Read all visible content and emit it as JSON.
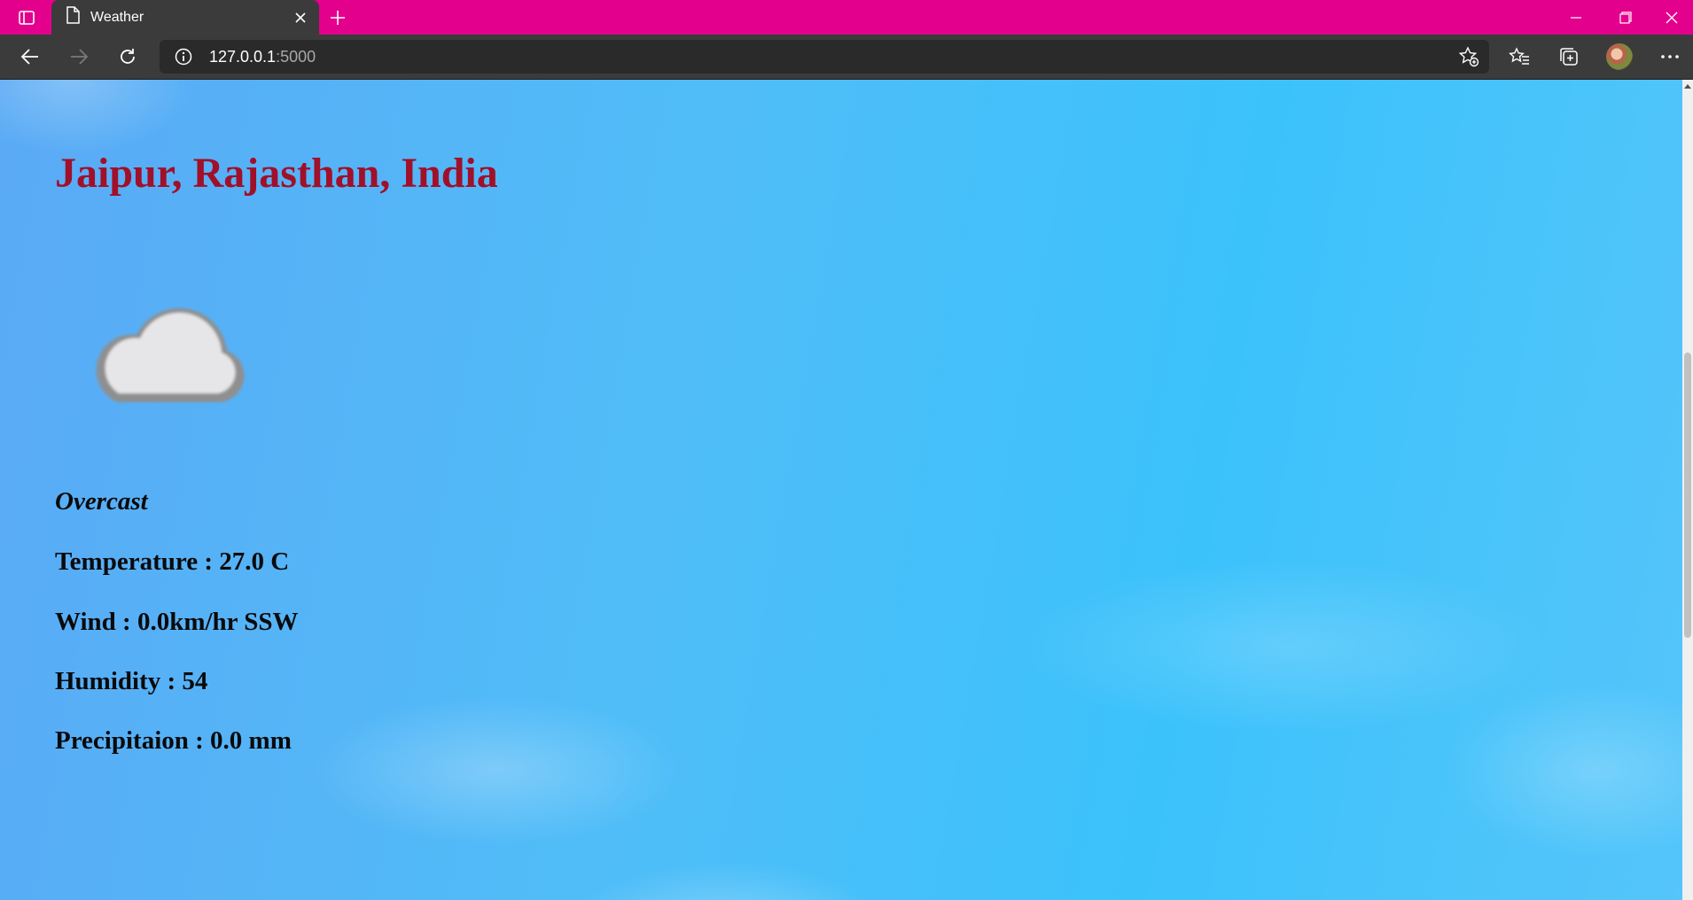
{
  "browser": {
    "tab_title": "Weather",
    "url_host": "127.0.0.1",
    "url_port": ":5000",
    "accent_color": "#e3008c"
  },
  "icons": {
    "tab_actions": "tab-actions-icon",
    "page": "page-icon",
    "close": "close-icon",
    "new_tab": "plus-icon",
    "minimize": "minimize-icon",
    "restore": "restore-icon",
    "window_close": "close-icon",
    "back": "back-arrow-icon",
    "forward": "forward-arrow-icon",
    "refresh": "refresh-icon",
    "info": "info-icon",
    "add_favorite": "star-add-icon",
    "favorites": "favorites-icon",
    "collections": "collections-icon",
    "profile": "avatar",
    "more": "more-icon",
    "weather": "cloud-icon"
  },
  "weather": {
    "location": "Jaipur, Rajasthan, India",
    "condition": "Overcast",
    "temperature": "Temperature : 27.0 C",
    "wind": "Wind : 0.0km/hr SSW",
    "humidity": "Humidity : 54",
    "precipitation": "Precipitaion : 0.0 mm",
    "title_color": "#a0102a"
  }
}
